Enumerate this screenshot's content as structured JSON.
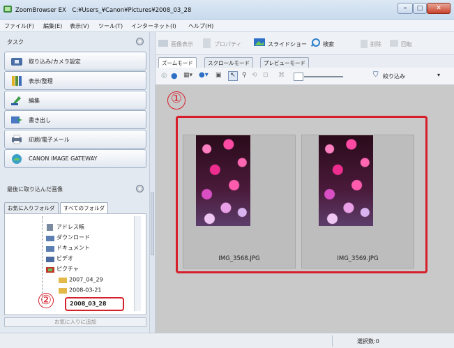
{
  "window": {
    "title": "ZoomBrowser EX　C:¥Users_¥Canon¥Pictures¥2008_03_28"
  },
  "menu": [
    "ファイル(F)",
    "編集(E)",
    "表示(V)",
    "ツール(T)",
    "インターネット(I)",
    "ヘルプ(H)"
  ],
  "tasks": {
    "header": "タスク",
    "items": [
      "取り込み/カメラ設定",
      "表示/整理",
      "編集",
      "書き出し",
      "印刷/電子メール",
      "CANON iMAGE GATEWAY"
    ]
  },
  "recent": {
    "header": "最後に取り込んだ画像"
  },
  "folder_tabs": [
    "お気に入りフォルダ",
    "すべてのフォルダ"
  ],
  "tree": [
    "アドレス帳",
    "ダウンロード",
    "ドキュメント",
    "ビデオ",
    "ピクチャ",
    "2007_04_29",
    "2008-03-21",
    "2008_03_28"
  ],
  "add_favorite_label": "お気に入りに追加",
  "toolbar": {
    "browse": "画像表示",
    "props": "プロパティ",
    "slideshow": "スライドショー",
    "search": "検索",
    "delete": "削除",
    "rotate": "回転"
  },
  "view_tabs": [
    "ズームモード",
    "スクロールモード",
    "プレビューモード"
  ],
  "filter_label": "絞り込み",
  "thumbnails": [
    {
      "filename": "IMG_3568.JPG"
    },
    {
      "filename": "IMG_3569.JPG"
    }
  ],
  "annotations": {
    "one": "①",
    "two": "②"
  },
  "status": {
    "selected": "選択数:0"
  },
  "colors": {
    "highlight": "#d61f2a",
    "content_bg": "#c9c9c9"
  }
}
